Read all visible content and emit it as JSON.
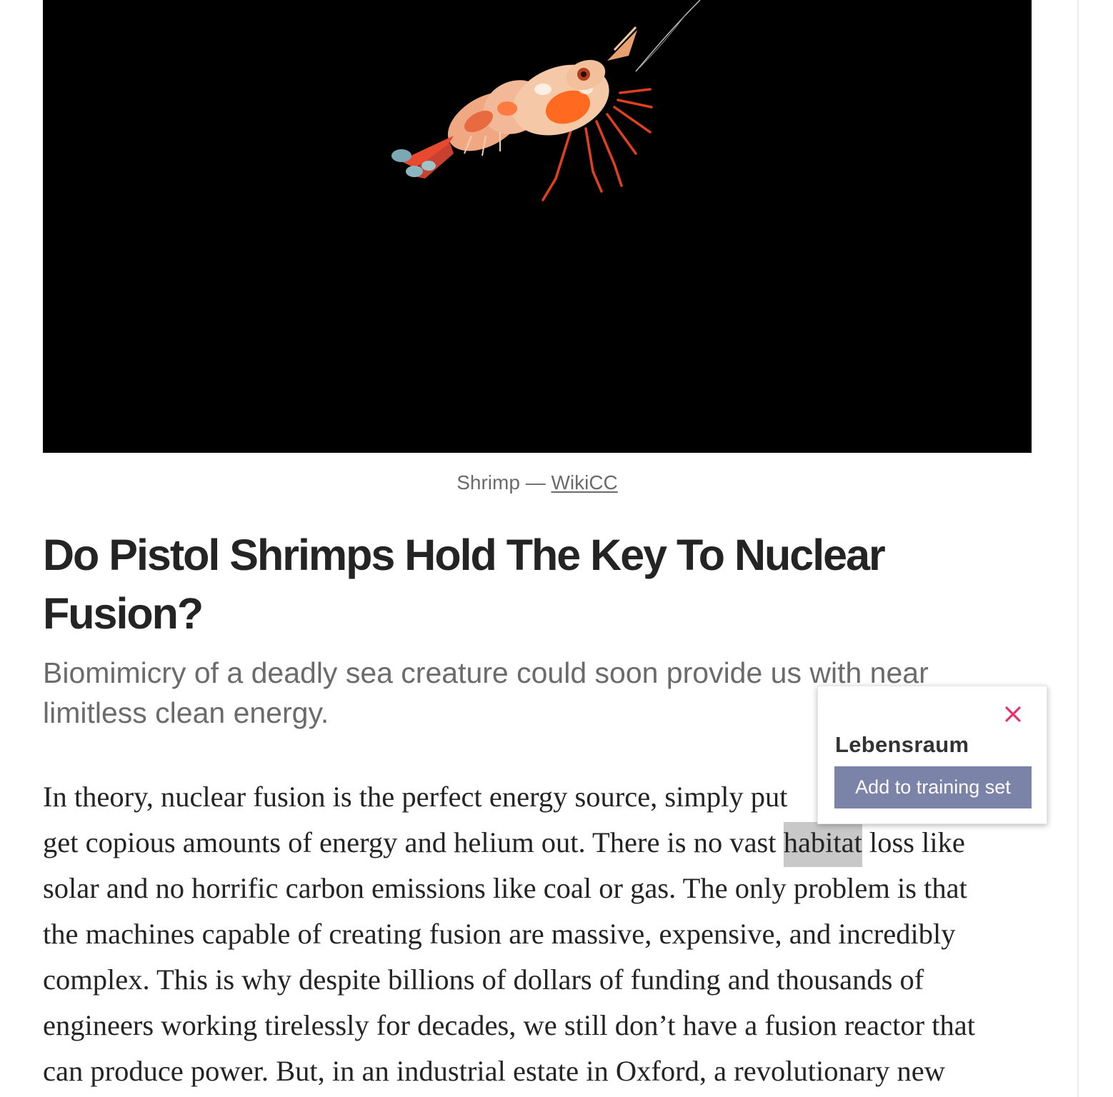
{
  "hero": {
    "image_alt": "Shrimp",
    "icon": "shrimp-illustration"
  },
  "caption": {
    "text": "Shrimp — ",
    "link": "WikiCC"
  },
  "article": {
    "title": "Do Pistol Shrimps Hold The Key To Nuclear Fusion?",
    "subtitle": "Biomimicry of a deadly sea creature could soon provide us with near limitless clean energy.",
    "body_lines": [
      "In theory, nuclear fusion is the perfect energy source, simply put",
      "get copious amounts of energy and helium out. There is no vast ",
      "solar and no horrific carbon emissions like coal or gas. The only problem is that",
      "the machines capable of creating fusion are massive, expensive, and incredibly",
      "complex. This is why despite billions of dollars of funding and thousands of",
      "engineers working tirelessly for decades, we still don’t have a fusion reactor that",
      "can produce power. But, in an industrial estate in Oxford, a revolutionary new"
    ],
    "highlighted_word": "habitat",
    "after_highlight": " loss like"
  },
  "popup": {
    "word": "Lebensraum",
    "button_label": "Add to training set",
    "close_icon": "close-icon",
    "close_color": "#e8336a",
    "button_color": "#7b84a8"
  }
}
